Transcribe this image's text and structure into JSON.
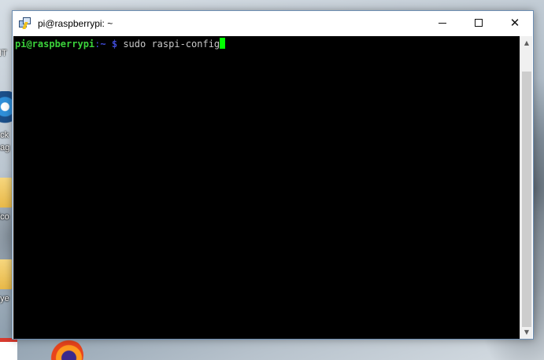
{
  "window": {
    "title": "pi@raspberrypi: ~",
    "controls": {
      "minimize_icon": "minimize-icon",
      "maximize_icon": "maximize-icon",
      "close_icon": "close-icon",
      "close_glyph": "✕"
    }
  },
  "terminal": {
    "user_host": "pi@raspberrypi",
    "separator": ":",
    "path": "~",
    "prompt_symbol": "$",
    "command": "sudo raspi-config",
    "colors": {
      "background": "#000000",
      "prompt_user": "#3bd23b",
      "prompt_path": "#3f4bd6",
      "command_text": "#c8c8c8",
      "cursor": "#00ff00"
    }
  },
  "scrollbar": {
    "up_glyph": "▲",
    "down_glyph": "▼"
  },
  "desktop": {
    "icon_labels": [
      "NT",
      "ock",
      "eag",
      "dco",
      "aye"
    ]
  }
}
